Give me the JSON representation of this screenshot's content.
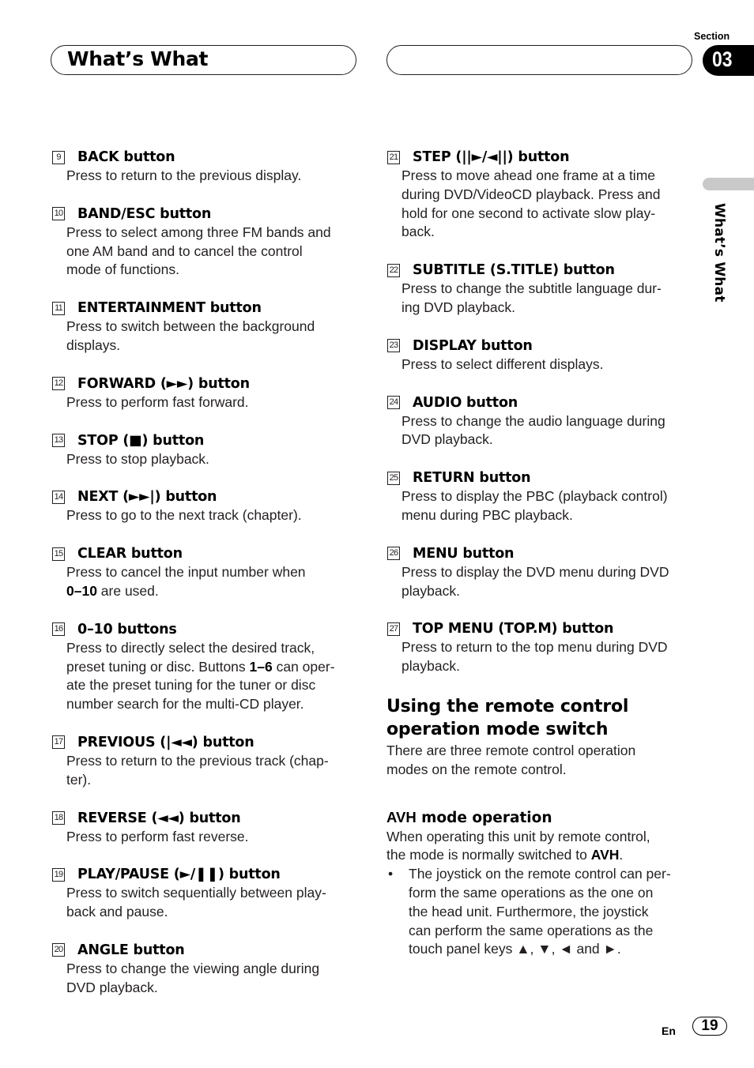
{
  "header": {
    "title": "What’s What",
    "section_label": "Section",
    "section_number": "03",
    "side_label": "What’s What"
  },
  "left_items": [
    {
      "num": "9",
      "title": "BACK button",
      "desc": [
        "Press to return to the previous display."
      ]
    },
    {
      "num": "10",
      "title": "BAND/ESC button",
      "desc": [
        "Press to select among three FM bands and",
        "one AM band and to cancel the control",
        "mode of functions."
      ]
    },
    {
      "num": "11",
      "title": "ENTERTAINMENT button",
      "desc": [
        "Press to switch between the background",
        "displays."
      ]
    },
    {
      "num": "12",
      "title": "FORWARD (►►) button",
      "desc": [
        "Press to perform fast forward."
      ]
    },
    {
      "num": "13",
      "title": "STOP (■) button",
      "desc": [
        "Press to stop playback."
      ]
    },
    {
      "num": "14",
      "title": "NEXT (►►|) button",
      "desc": [
        "Press to go to the next track (chapter)."
      ]
    },
    {
      "num": "15",
      "title": "CLEAR button",
      "desc_parts": [
        {
          "text": "Press to cancel the input number when",
          "bold": false,
          "br": true
        },
        {
          "text": "0–10",
          "bold": true
        },
        {
          "text": " are used.",
          "bold": false
        }
      ]
    },
    {
      "num": "16",
      "title": "0–10 buttons",
      "desc_parts": [
        {
          "text": "Press to directly select the desired track,",
          "bold": false,
          "br": true
        },
        {
          "text": "preset tuning or disc. Buttons ",
          "bold": false
        },
        {
          "text": "1–6",
          "bold": true
        },
        {
          "text": " can oper-",
          "bold": false,
          "br": true
        },
        {
          "text": "ate the preset tuning for the tuner or disc",
          "bold": false,
          "br": true
        },
        {
          "text": "number search for the multi-CD player.",
          "bold": false
        }
      ]
    },
    {
      "num": "17",
      "title": "PREVIOUS (|◄◄) button",
      "desc": [
        "Press to return to the previous track (chap-",
        "ter)."
      ]
    },
    {
      "num": "18",
      "title": "REVERSE (◄◄) button",
      "desc": [
        "Press to perform fast reverse."
      ]
    },
    {
      "num": "19",
      "title": "PLAY/PAUSE (►/❚❚) button",
      "desc": [
        "Press to switch sequentially between play-",
        "back and pause."
      ]
    },
    {
      "num": "20",
      "title": "ANGLE button",
      "desc": [
        "Press to change the viewing angle during",
        "DVD playback."
      ]
    }
  ],
  "right_items": [
    {
      "num": "21",
      "title": "STEP (||►/◄||) button",
      "desc": [
        "Press to move ahead one frame at a time",
        "during DVD/VideoCD playback. Press and",
        "hold for one second to activate slow play-",
        "back."
      ]
    },
    {
      "num": "22",
      "title": "SUBTITLE (S.TITLE) button",
      "desc": [
        "Press to change the subtitle language dur-",
        "ing DVD playback."
      ]
    },
    {
      "num": "23",
      "title": "DISPLAY button",
      "desc": [
        "Press to select different displays."
      ]
    },
    {
      "num": "24",
      "title": "AUDIO button",
      "desc": [
        "Press to change the audio language during",
        "DVD playback."
      ]
    },
    {
      "num": "25",
      "title": "RETURN button",
      "desc": [
        "Press to display the PBC (playback control)",
        "menu during PBC playback."
      ]
    },
    {
      "num": "26",
      "title": "MENU button",
      "desc": [
        "Press to display the DVD menu during DVD",
        "playback."
      ]
    },
    {
      "num": "27",
      "title": "TOP MENU (TOP.M) button",
      "desc": [
        "Press to return to the top menu during DVD",
        "playback."
      ]
    }
  ],
  "remote_section": {
    "heading_line1": "Using the remote control",
    "heading_line2": "operation mode switch",
    "intro_line1": "There are three remote control operation",
    "intro_line2": "modes on the remote control.",
    "sub_heading_avh": "AVH",
    "sub_heading_rest": " mode operation",
    "para_line1": "When operating this unit by remote control,",
    "para_line2_text": "the mode is normally switched to ",
    "para_line2_bold": "AVH",
    "para_line2_end": ".",
    "bullet_char": "•",
    "bullet_lines": [
      "The joystick on the remote control can per-",
      "form the same operations as the one on",
      "the head unit. Furthermore, the joystick",
      "can perform the same operations as the",
      "touch panel keys ▲, ▼, ◄ and ►."
    ]
  },
  "footer": {
    "language": "En",
    "page_number": "19"
  }
}
